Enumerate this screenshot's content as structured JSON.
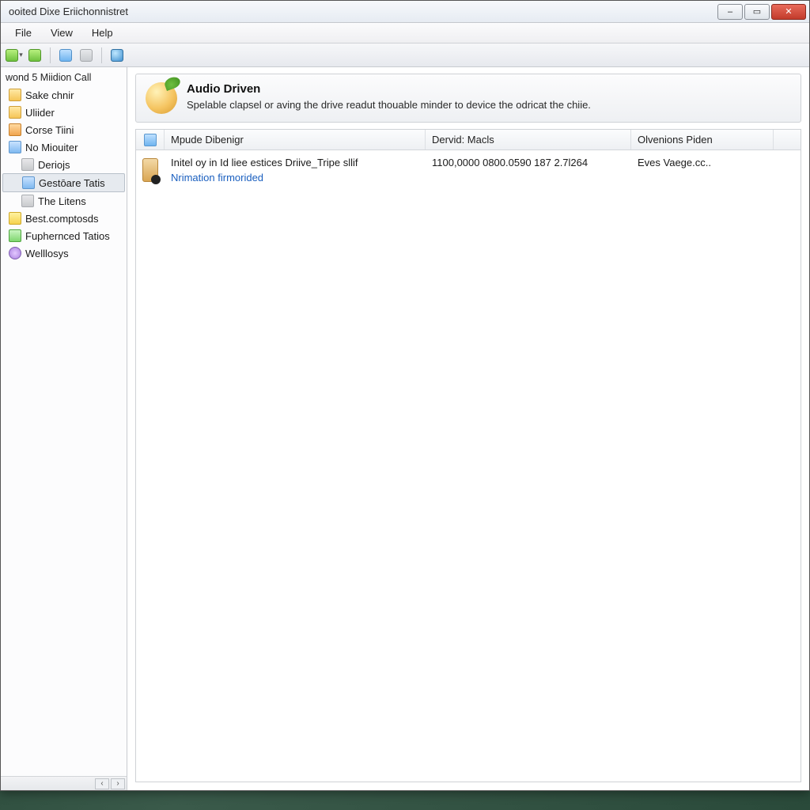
{
  "window": {
    "title": "ooited Dixe Eriichonnistret"
  },
  "menu": {
    "file": "File",
    "view": "View",
    "help": "Help"
  },
  "sidebar": {
    "heading": "wond 5 Miidion Call",
    "items": [
      {
        "label": "Sake chnir",
        "icon": "folder"
      },
      {
        "label": "Uliider",
        "icon": "folder"
      },
      {
        "label": "Corse Tiini",
        "icon": "orange"
      },
      {
        "label": "No Miouiter",
        "icon": "blue"
      },
      {
        "label": "Deriojs",
        "icon": "grey",
        "indent": true
      },
      {
        "label": "Gestōare Tatis",
        "icon": "blue",
        "indent": true,
        "selected": true
      },
      {
        "label": "The Litens",
        "icon": "grey",
        "indent": true
      },
      {
        "label": "Best.comptosds",
        "icon": "yellow"
      },
      {
        "label": "Fuphernced Tatios",
        "icon": "green"
      },
      {
        "label": "Welllosys",
        "icon": "purple"
      }
    ]
  },
  "panel": {
    "title": "Audio Driven",
    "subtitle": "Spelable clapsel or aving the drive readut thouable minder to device the odricat the chiie."
  },
  "columns": {
    "c1": "Mpude Dibenigr",
    "c2": "Dervid: Macls",
    "c3": "Olvenions Piden"
  },
  "rows": [
    {
      "c1": "Initel oy in Id liee estices Driive_Tripe sllif",
      "c1_sub": "Nrimation firmorided",
      "c2": "1100,0000 0800.0590 187 2.7l264",
      "c3": "Eves Vaege.cc.."
    }
  ]
}
